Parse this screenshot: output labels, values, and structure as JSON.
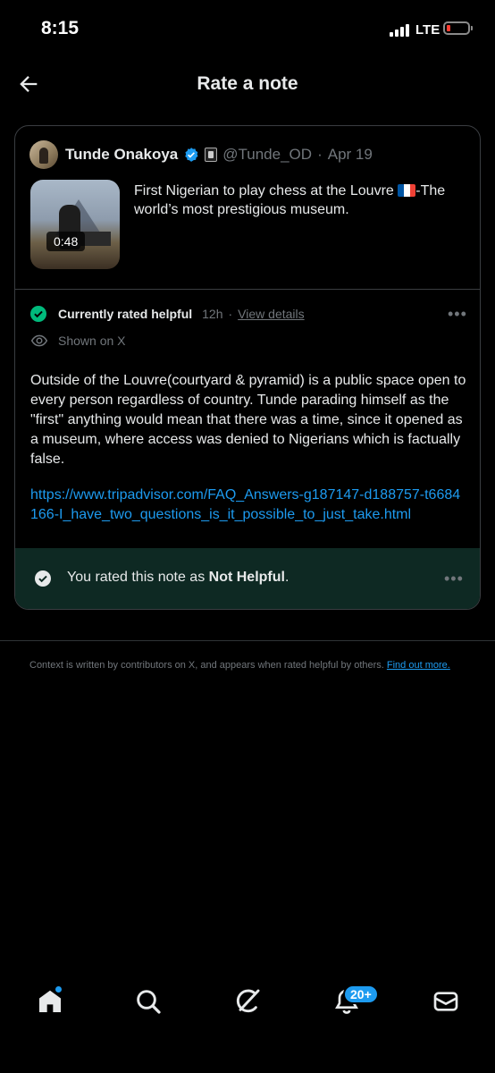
{
  "status_bar": {
    "time": "8:15",
    "network": "LTE"
  },
  "header": {
    "title": "Rate a note"
  },
  "tweet": {
    "author_name": "Tunde Onakoya",
    "handle": "@Tunde_OD",
    "separator": "·",
    "date": "Apr 19",
    "video_duration": "0:48",
    "text_before_flag": "First Nigerian to play chess at the Louvre ",
    "text_after_flag": "-The world’s most prestigious museum."
  },
  "note": {
    "status": "Currently rated helpful",
    "age": "12h",
    "separator": "·",
    "view_details": "View details",
    "shown_on": "Shown on X",
    "body": "Outside of the Louvre(courtyard & pyramid) is a public space open to every person regardless of country. Tunde parading himself as the \"first\" anything would mean that there was a time, since it opened as a museum, where access was denied to Nigerians which is factually false.",
    "link": "https://www.tripadvisor.com/FAQ_Answers-g187147-d188757-t6684166-I_have_two_questions_is_it_possible_to_just_take.html"
  },
  "rating": {
    "prefix": "You rated this note as ",
    "value": "Not Helpful",
    "suffix": "."
  },
  "footer": {
    "text": "Context is written by contributors on X, and appears when rated helpful by others. ",
    "link": "Find out more."
  },
  "tabbar": {
    "items": [
      "home-icon",
      "search-icon",
      "grok-icon",
      "notifications-icon",
      "messages-icon"
    ],
    "notification_badge": "20+"
  },
  "colors": {
    "accent": "#1d9bf0",
    "helpful_green": "#00ba7c",
    "rated_bar_bg": "#0e2923",
    "battery_low": "#ff3b30"
  }
}
